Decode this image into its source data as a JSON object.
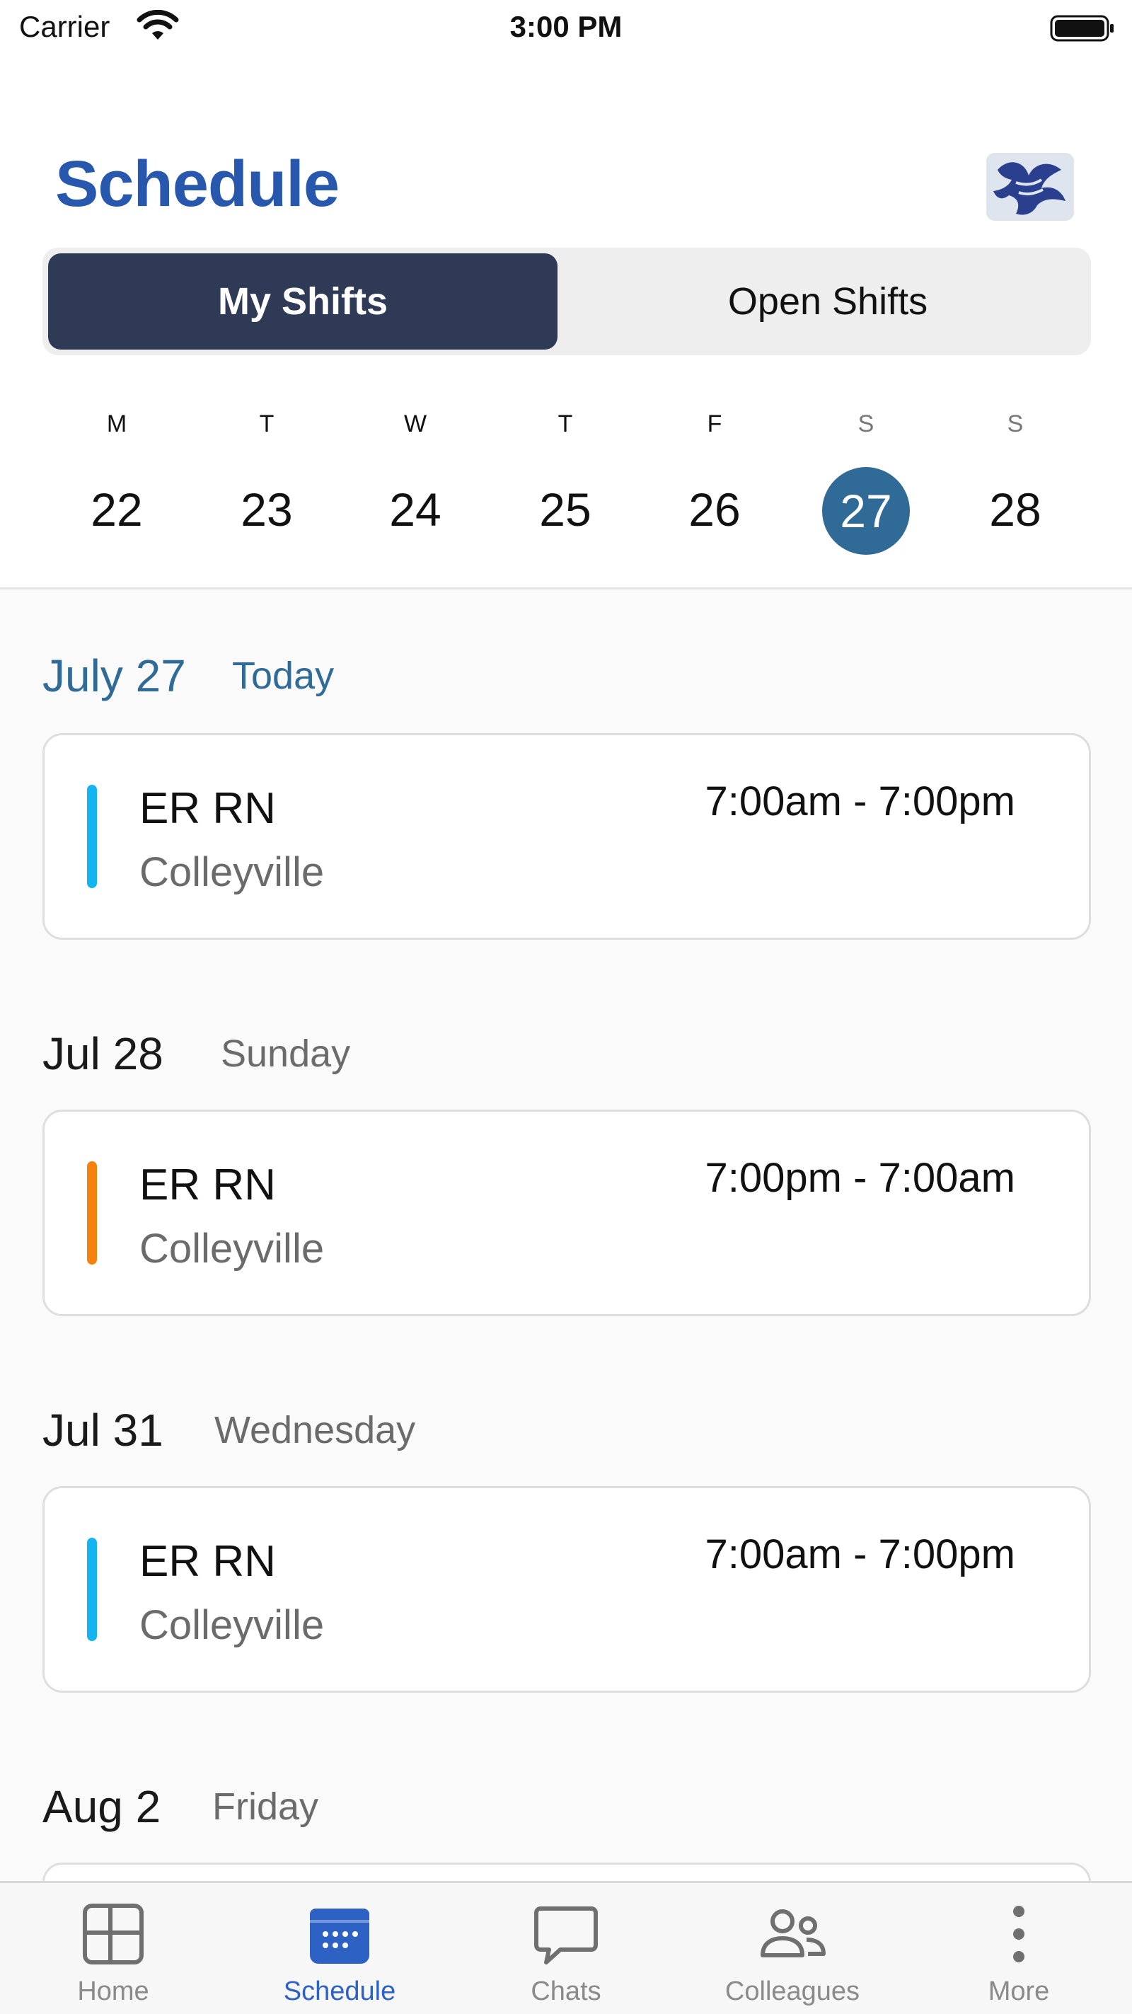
{
  "status_bar": {
    "carrier": "Carrier",
    "time": "3:00 PM"
  },
  "header": {
    "title": "Schedule"
  },
  "segmented": {
    "my_shifts": "My Shifts",
    "open_shifts": "Open Shifts",
    "selected": "My Shifts"
  },
  "week": {
    "days": [
      {
        "letter": "M",
        "num": "22"
      },
      {
        "letter": "T",
        "num": "23"
      },
      {
        "letter": "W",
        "num": "24"
      },
      {
        "letter": "T",
        "num": "25"
      },
      {
        "letter": "F",
        "num": "26"
      },
      {
        "letter": "S",
        "num": "27",
        "selected": true
      },
      {
        "letter": "S",
        "num": "28"
      }
    ]
  },
  "sections": [
    {
      "date": "July 27",
      "sub": "Today",
      "shift": {
        "role": "ER RN",
        "location": "Colleyville",
        "time": "7:00am - 7:00pm",
        "color": "#14b4f0"
      }
    },
    {
      "date": "Jul 28",
      "sub": "Sunday",
      "shift": {
        "role": "ER RN",
        "location": "Colleyville",
        "time": "7:00pm - 7:00am",
        "color": "#f5820f"
      }
    },
    {
      "date": "Jul 31",
      "sub": "Wednesday",
      "shift": {
        "role": "ER RN",
        "location": "Colleyville",
        "time": "7:00am - 7:00pm",
        "color": "#14b4f0"
      }
    },
    {
      "date": "Aug 2",
      "sub": "Friday"
    }
  ],
  "tabbar": {
    "items": [
      {
        "label": "Home",
        "icon": "home-grid-icon"
      },
      {
        "label": "Schedule",
        "icon": "calendar-icon",
        "active": true
      },
      {
        "label": "Chats",
        "icon": "chat-bubble-icon"
      },
      {
        "label": "Colleagues",
        "icon": "people-icon"
      },
      {
        "label": "More",
        "icon": "more-vertical-icon"
      }
    ]
  },
  "colors": {
    "brand_title": "#2758ae",
    "segment_active": "#2f3a57",
    "selected_day": "#2f6b96",
    "tab_active": "#2d62c4"
  }
}
